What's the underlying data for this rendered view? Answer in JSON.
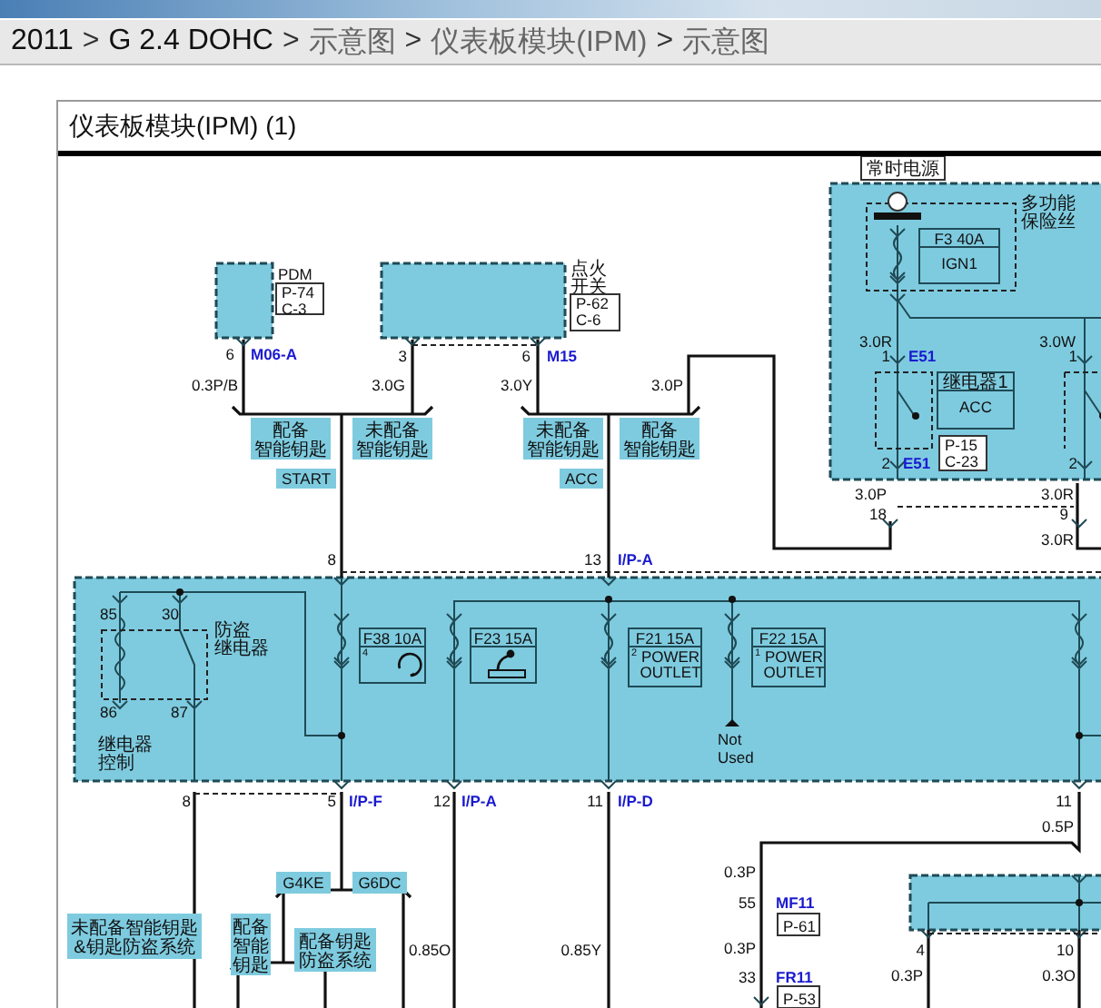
{
  "breadcrumb": {
    "separator": ">",
    "items": [
      {
        "label": "2011",
        "link": false
      },
      {
        "label": "G 2.4 DOHC",
        "link": false
      },
      {
        "label": "示意图",
        "link": true
      },
      {
        "label": "仪表板模块(IPM)",
        "link": true
      },
      {
        "label": "示意图",
        "link": true
      }
    ]
  },
  "diagram_title": "仪表板模块(IPM) (1)",
  "diagram": {
    "labels": [
      {
        "kind": "text",
        "lines": [
          "PDM"
        ]
      },
      {
        "kind": "ref",
        "lines": [
          "P-74",
          "C-3"
        ]
      },
      {
        "kind": "text",
        "lines": [
          "点火",
          "开关"
        ]
      },
      {
        "kind": "ref",
        "lines": [
          "P-62",
          "C-6"
        ]
      },
      {
        "kind": "text",
        "lines": [
          "6"
        ]
      },
      {
        "kind": "connector",
        "lines": [
          "M06-A"
        ]
      },
      {
        "kind": "text",
        "lines": [
          "3"
        ]
      },
      {
        "kind": "text",
        "lines": [
          "6"
        ]
      },
      {
        "kind": "connector",
        "lines": [
          "M15"
        ]
      },
      {
        "kind": "text",
        "lines": [
          "0.3P/B"
        ]
      },
      {
        "kind": "text",
        "lines": [
          "3.0G"
        ]
      },
      {
        "kind": "text",
        "lines": [
          "3.0Y"
        ]
      },
      {
        "kind": "text",
        "lines": [
          "3.0P"
        ]
      },
      {
        "kind": "tag",
        "lines": [
          "配备",
          "智能钥匙"
        ]
      },
      {
        "kind": "tag",
        "lines": [
          "未配备",
          "智能钥匙"
        ]
      },
      {
        "kind": "tag",
        "lines": [
          "未配备",
          "智能钥匙"
        ]
      },
      {
        "kind": "tag",
        "lines": [
          "配备",
          "智能钥匙"
        ]
      },
      {
        "kind": "tag",
        "lines": [
          "START"
        ]
      },
      {
        "kind": "tag",
        "lines": [
          "ACC"
        ]
      },
      {
        "kind": "text",
        "lines": [
          "8"
        ]
      },
      {
        "kind": "text",
        "lines": [
          "13"
        ]
      },
      {
        "kind": "connector",
        "lines": [
          "I/P-A"
        ]
      },
      {
        "kind": "ref",
        "lines": [
          "常时电源"
        ]
      },
      {
        "kind": "text",
        "lines": [
          "多功能",
          "保险丝"
        ]
      },
      {
        "kind": "titled",
        "title": "F3 40A",
        "lines": [
          "IGN1"
        ]
      },
      {
        "kind": "text",
        "lines": [
          "3.0R"
        ]
      },
      {
        "kind": "text",
        "lines": [
          "3.0W"
        ]
      },
      {
        "kind": "text",
        "lines": [
          "1"
        ]
      },
      {
        "kind": "connector",
        "lines": [
          "E51"
        ]
      },
      {
        "kind": "text",
        "lines": [
          "1"
        ]
      },
      {
        "kind": "titled",
        "title": "继电器1",
        "lines": [
          "ACC"
        ]
      },
      {
        "kind": "text",
        "lines": [
          "2"
        ]
      },
      {
        "kind": "connector",
        "lines": [
          "E51"
        ]
      },
      {
        "kind": "ref",
        "lines": [
          "P-15",
          "C-23"
        ]
      },
      {
        "kind": "text",
        "lines": [
          "2"
        ]
      },
      {
        "kind": "text",
        "lines": [
          "3.0P"
        ]
      },
      {
        "kind": "text",
        "lines": [
          "18"
        ]
      },
      {
        "kind": "text",
        "lines": [
          "3.0R"
        ]
      },
      {
        "kind": "text",
        "lines": [
          "9"
        ]
      },
      {
        "kind": "text",
        "lines": [
          "3.0R"
        ]
      },
      {
        "kind": "text",
        "lines": [
          "85"
        ]
      },
      {
        "kind": "text",
        "lines": [
          "30"
        ]
      },
      {
        "kind": "text",
        "lines": [
          "防盗",
          "继电器"
        ]
      },
      {
        "kind": "text",
        "lines": [
          "86"
        ]
      },
      {
        "kind": "text",
        "lines": [
          "87"
        ]
      },
      {
        "kind": "text",
        "lines": [
          "继电器",
          "控制"
        ]
      },
      {
        "kind": "titled",
        "title": "F38 10A",
        "index": "4"
      },
      {
        "kind": "titled",
        "title": "F23 15A"
      },
      {
        "kind": "titled",
        "title": "F21 15A",
        "index": "2",
        "lines": [
          "POWER",
          "OUTLET"
        ]
      },
      {
        "kind": "titled",
        "title": "F22 15A",
        "index": "1",
        "lines": [
          "POWER",
          "OUTLET"
        ]
      },
      {
        "kind": "text",
        "lines": [
          "Not",
          "Used"
        ]
      },
      {
        "kind": "text",
        "lines": [
          "8"
        ]
      },
      {
        "kind": "text",
        "lines": [
          "5"
        ]
      },
      {
        "kind": "connector",
        "lines": [
          "I/P-F"
        ]
      },
      {
        "kind": "text",
        "lines": [
          "12"
        ]
      },
      {
        "kind": "connector",
        "lines": [
          "I/P-A"
        ]
      },
      {
        "kind": "text",
        "lines": [
          "11"
        ]
      },
      {
        "kind": "connector",
        "lines": [
          "I/P-D"
        ]
      },
      {
        "kind": "text",
        "lines": [
          "11"
        ]
      },
      {
        "kind": "text",
        "lines": [
          "0.5P"
        ]
      },
      {
        "kind": "tag",
        "lines": [
          "G4KE"
        ]
      },
      {
        "kind": "tag",
        "lines": [
          "G6DC"
        ]
      },
      {
        "kind": "tag",
        "lines": [
          "未配备智能钥匙",
          "&钥匙防盗系统"
        ]
      },
      {
        "kind": "tag",
        "lines": [
          "配备",
          "智能",
          "钥匙"
        ]
      },
      {
        "kind": "tag",
        "lines": [
          "配备钥匙",
          "防盗系统"
        ]
      },
      {
        "kind": "text",
        "lines": [
          "0.85O"
        ]
      },
      {
        "kind": "text",
        "lines": [
          "0.85Y"
        ]
      },
      {
        "kind": "text",
        "lines": [
          "0.3P"
        ]
      },
      {
        "kind": "text",
        "lines": [
          "55"
        ]
      },
      {
        "kind": "connector",
        "lines": [
          "MF11"
        ]
      },
      {
        "kind": "ref",
        "lines": [
          "P-61"
        ]
      },
      {
        "kind": "text",
        "lines": [
          "0.3P"
        ]
      },
      {
        "kind": "text",
        "lines": [
          "33"
        ]
      },
      {
        "kind": "connector",
        "lines": [
          "FR11"
        ]
      },
      {
        "kind": "ref",
        "lines": [
          "P-53"
        ]
      },
      {
        "kind": "text",
        "lines": [
          "4"
        ]
      },
      {
        "kind": "text",
        "lines": [
          "10"
        ]
      },
      {
        "kind": "text",
        "lines": [
          "0.3P"
        ]
      },
      {
        "kind": "text",
        "lines": [
          "0.3O"
        ]
      }
    ]
  }
}
